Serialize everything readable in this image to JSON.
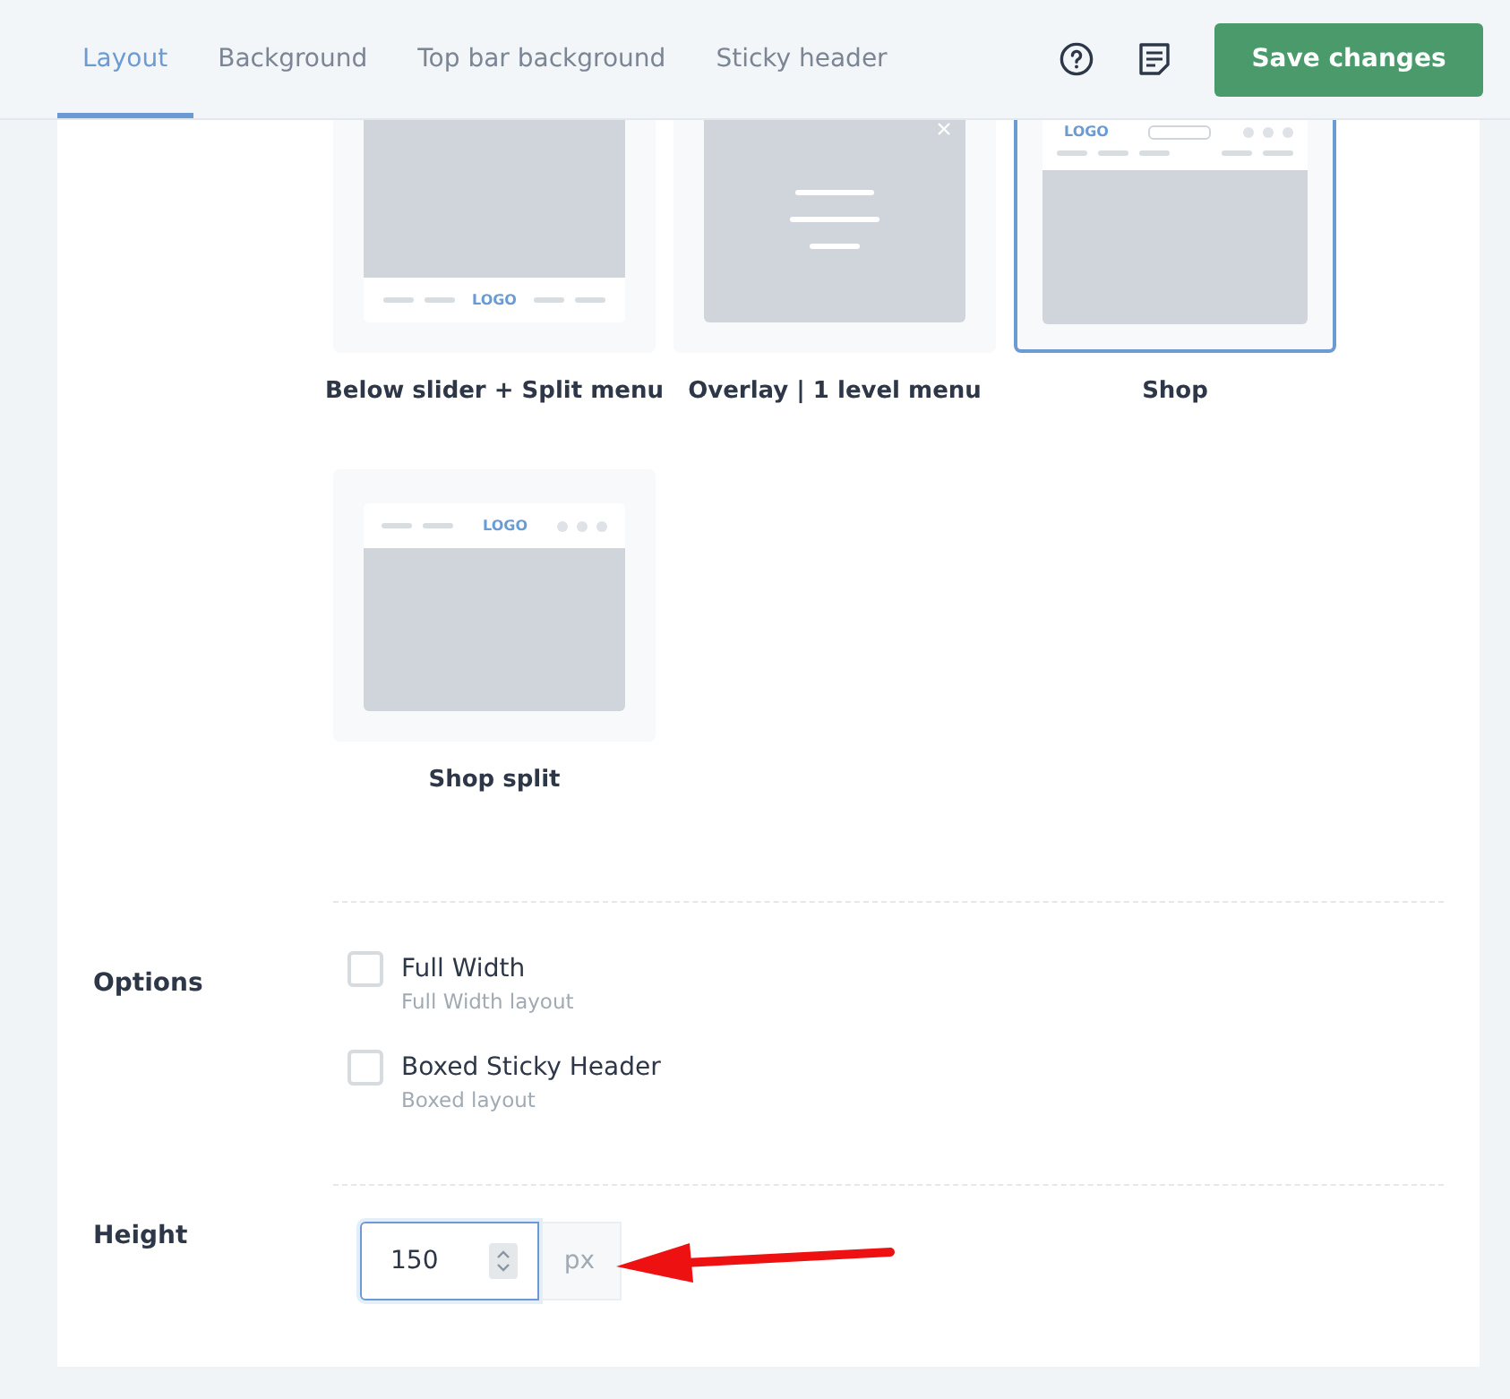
{
  "tabs": [
    {
      "label": "Layout",
      "selected": true
    },
    {
      "label": "Background",
      "selected": false
    },
    {
      "label": "Top bar background",
      "selected": false
    },
    {
      "label": "Sticky header",
      "selected": false
    }
  ],
  "save_button": "Save changes",
  "layout_tiles": [
    {
      "label": "Below slider + Split menu",
      "kind": "below_split",
      "selected": false,
      "logo": "LOGO"
    },
    {
      "label": "Overlay | 1 level menu",
      "kind": "overlay",
      "selected": false
    },
    {
      "label": "Shop",
      "kind": "shop",
      "selected": true,
      "logo": "LOGO"
    },
    {
      "label": "Shop split",
      "kind": "shop_split",
      "selected": false,
      "logo": "LOGO"
    }
  ],
  "options": {
    "label": "Options",
    "items": [
      {
        "label": "Full Width",
        "description": "Full Width layout",
        "checked": false
      },
      {
        "label": "Boxed Sticky Header",
        "description": "Boxed layout",
        "checked": false
      }
    ]
  },
  "height": {
    "label": "Height",
    "value": "150",
    "unit": "px"
  }
}
